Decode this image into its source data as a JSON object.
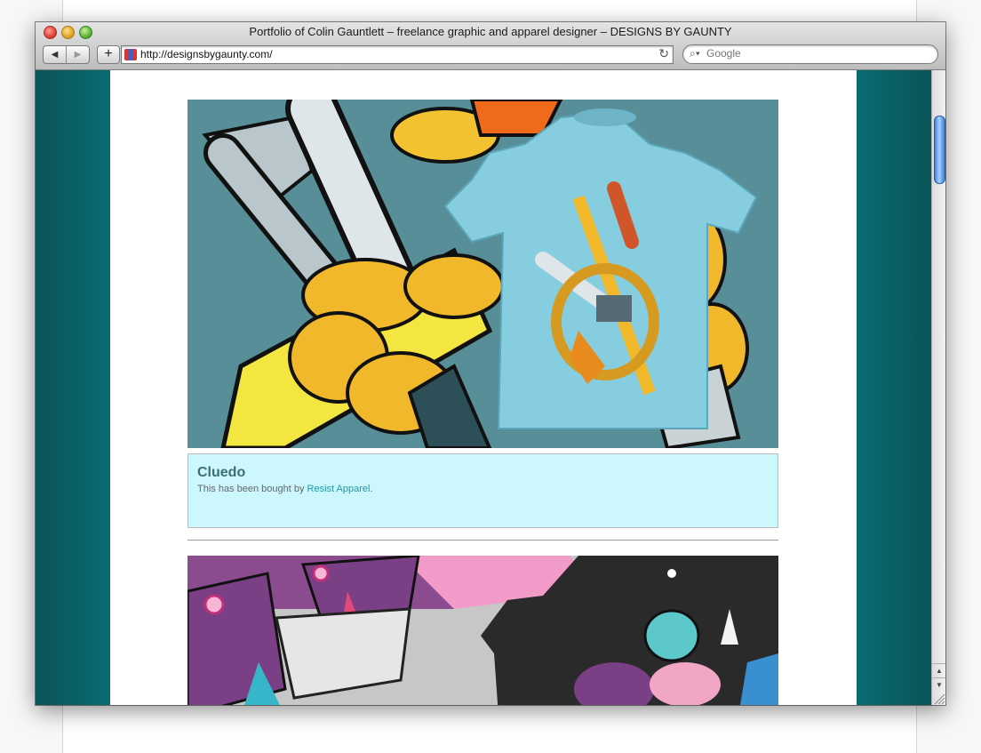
{
  "window": {
    "title": "Portfolio of Colin Gauntlett – freelance graphic and apparel designer – DESIGNS BY GAUNTY"
  },
  "toolbar": {
    "back_icon": "back-arrow-icon",
    "forward_icon": "forward-arrow-icon",
    "add_bookmark_label": "+",
    "url": "http://designsbygaunty.com/",
    "reload_icon": "reload-icon",
    "search_placeholder": "Google"
  },
  "portfolio": {
    "items": [
      {
        "title": "Cluedo",
        "caption_prefix": "This has been bought by",
        "link_text": "Resist Apparel",
        "caption_suffix": "."
      }
    ]
  },
  "colors": {
    "page_background": "#0a6a70",
    "caption_background": "#ccf7fd",
    "link": "#1f9aa8",
    "artwork_1_background": "#578e98"
  }
}
